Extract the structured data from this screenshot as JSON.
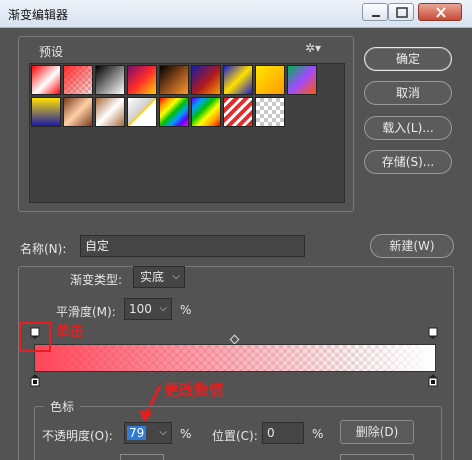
{
  "window": {
    "title": "渐变编辑器"
  },
  "presets": {
    "label": "预设",
    "gear_icon": "gear-icon"
  },
  "buttons": {
    "ok": "确定",
    "cancel": "取消",
    "load": "载入(L)...",
    "save": "存储(S)..."
  },
  "name": {
    "label": "名称(N):",
    "value": "自定",
    "new_button": "新建(W)"
  },
  "gradient": {
    "type_label": "渐变类型:",
    "type_value": "实底",
    "smooth_label": "平滑度(M):",
    "smooth_value": "100",
    "smooth_unit": "%"
  },
  "annotations": {
    "click_hint": "单击",
    "change_hint": "更改数值"
  },
  "color_stops": {
    "legend": "色标",
    "opacity_label": "不透明度(O):",
    "opacity_value": "79",
    "opacity_unit": "%",
    "position_label": "位置(C):",
    "position_value": "0",
    "position_unit": "%",
    "delete_button": "删除(D)"
  },
  "colors": {
    "annotation": "#e51f1f",
    "selection": "#2f7bd6"
  }
}
